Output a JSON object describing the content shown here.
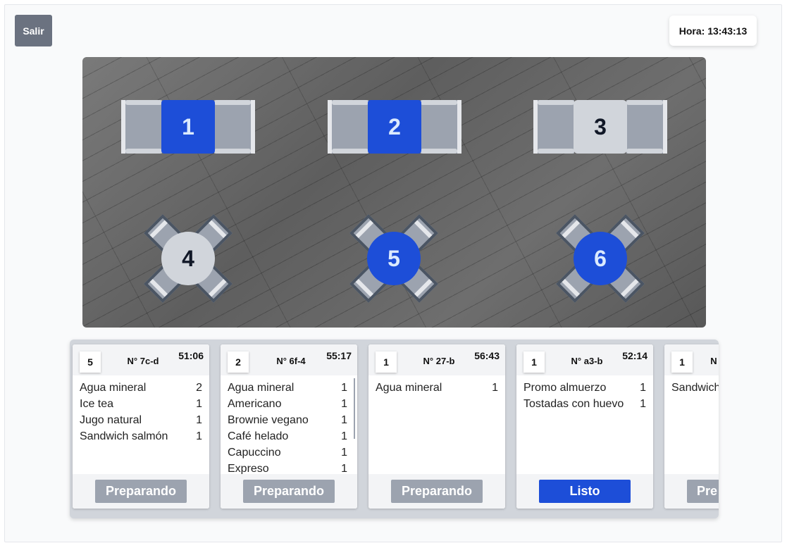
{
  "header": {
    "exit_label": "Salir",
    "clock": "Hora: 13:43:13"
  },
  "tables": [
    {
      "number": "1",
      "shape": "rect",
      "occupied": true
    },
    {
      "number": "2",
      "shape": "rect",
      "occupied": true
    },
    {
      "number": "3",
      "shape": "rect",
      "occupied": false
    },
    {
      "number": "4",
      "shape": "round",
      "occupied": false
    },
    {
      "number": "5",
      "shape": "round",
      "occupied": true
    },
    {
      "number": "6",
      "shape": "round",
      "occupied": true
    }
  ],
  "orders": [
    {
      "table": "5",
      "number": "N° 7c-d",
      "elapsed": "51:06",
      "items": [
        {
          "name": "Agua mineral",
          "qty": "2"
        },
        {
          "name": "Ice tea",
          "qty": "1"
        },
        {
          "name": "Jugo natural",
          "qty": "1"
        },
        {
          "name": "Sandwich salmón",
          "qty": "1"
        }
      ],
      "status": "Preparando"
    },
    {
      "table": "2",
      "number": "N° 6f-4",
      "elapsed": "55:17",
      "items": [
        {
          "name": "Agua mineral",
          "qty": "1"
        },
        {
          "name": "Americano",
          "qty": "1"
        },
        {
          "name": "Brownie vegano",
          "qty": "1"
        },
        {
          "name": "Café helado",
          "qty": "1"
        },
        {
          "name": "Capuccino",
          "qty": "1"
        },
        {
          "name": "Expreso",
          "qty": "1"
        }
      ],
      "status": "Preparando"
    },
    {
      "table": "1",
      "number": "N° 27-b",
      "elapsed": "56:43",
      "items": [
        {
          "name": "Agua mineral",
          "qty": "1"
        }
      ],
      "status": "Preparando"
    },
    {
      "table": "1",
      "number": "N° a3-b",
      "elapsed": "52:14",
      "items": [
        {
          "name": "Promo almuerzo",
          "qty": "1"
        },
        {
          "name": "Tostadas con huevo",
          "qty": "1"
        }
      ],
      "status": "Listo"
    },
    {
      "table": "1",
      "number": "N",
      "elapsed": "",
      "items": [
        {
          "name": "Sandwich",
          "qty": ""
        }
      ],
      "status": "Pre"
    }
  ],
  "colors": {
    "occupied": "#1d4ed8",
    "free": "#d1d5db",
    "ready_button": "#1d4ed8",
    "preparing_button": "#9ca3af"
  }
}
